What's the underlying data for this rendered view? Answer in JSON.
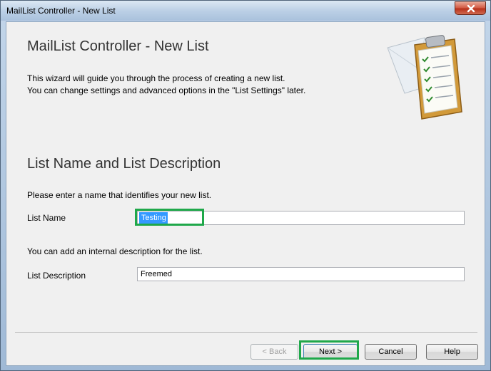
{
  "window": {
    "title": "MailList Controller - New List"
  },
  "header": {
    "heading": "MailList Controller - New List",
    "intro_line1": "This wizard will guide you through the process of creating a new list.",
    "intro_line2": "You can change settings and advanced options in the \"List Settings\" later."
  },
  "section": {
    "title": "List Name and List Description",
    "name_prompt": "Please enter a name that identifies your new list.",
    "name_label": "List Name",
    "name_value": "Testing",
    "desc_prompt": "You can add an internal description for the list.",
    "desc_label": "List Description",
    "desc_value": "Freemed"
  },
  "buttons": {
    "back": "< Back",
    "next": "Next >",
    "cancel": "Cancel",
    "help": "Help"
  },
  "colors": {
    "highlight_box": "#1fa84a",
    "selection": "#3399ff"
  }
}
